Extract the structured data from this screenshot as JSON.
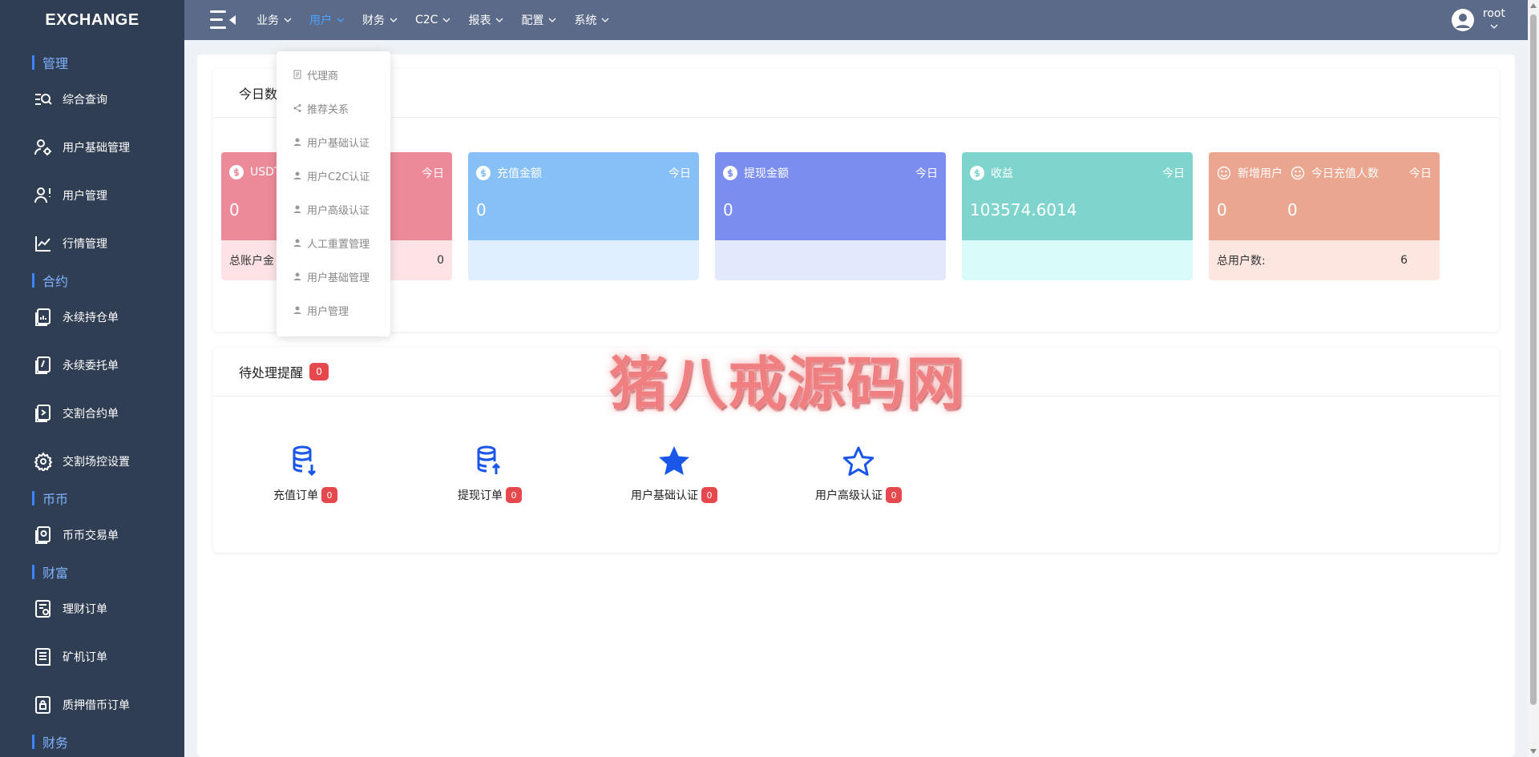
{
  "app": {
    "logo": "EXCHANGE"
  },
  "sidebar": {
    "sections": [
      {
        "title": "管理",
        "items": [
          {
            "label": "综合查询",
            "icon": "search-list-icon"
          },
          {
            "label": "用户基础管理",
            "icon": "user-settings-icon"
          },
          {
            "label": "用户管理",
            "icon": "user-alert-icon"
          },
          {
            "label": "行情管理",
            "icon": "line-chart-icon"
          }
        ]
      },
      {
        "title": "合约",
        "items": [
          {
            "label": "永续持仓单",
            "icon": "chart-doc-icon"
          },
          {
            "label": "永续委托单",
            "icon": "entrust-doc-icon"
          },
          {
            "label": "交割合约单",
            "icon": "contract-doc-icon"
          },
          {
            "label": "交割场控设置",
            "icon": "gear-icon"
          }
        ]
      },
      {
        "title": "币币",
        "items": [
          {
            "label": "币币交易单",
            "icon": "coin-doc-icon"
          }
        ]
      },
      {
        "title": "财富",
        "items": [
          {
            "label": "理财订单",
            "icon": "finance-doc-icon"
          },
          {
            "label": "矿机订单",
            "icon": "list-doc-icon"
          },
          {
            "label": "质押借币订单",
            "icon": "lock-doc-icon"
          }
        ]
      },
      {
        "title": "财务",
        "items": []
      }
    ]
  },
  "topnav": {
    "items": [
      "业务",
      "用户",
      "财务",
      "C2C",
      "报表",
      "配置",
      "系统"
    ],
    "active": "用户",
    "user": "root"
  },
  "dropdown": {
    "items": [
      {
        "label": "代理商",
        "icon": "doc-icon"
      },
      {
        "label": "推荐关系",
        "icon": "share-icon"
      },
      {
        "label": "用户基础认证",
        "icon": "person-icon"
      },
      {
        "label": "用户C2C认证",
        "icon": "person-icon"
      },
      {
        "label": "用户高级认证",
        "icon": "person-icon"
      },
      {
        "label": "人工重置管理",
        "icon": "person-icon"
      },
      {
        "label": "用户基础管理",
        "icon": "person-icon"
      },
      {
        "label": "用户管理",
        "icon": "person-icon"
      }
    ]
  },
  "today_panel": {
    "title": "今日数",
    "cards": [
      {
        "title": "USDT",
        "today": "今日",
        "value": "0",
        "footer_label": "总账户金",
        "footer_value": "0",
        "top_color": "#ec8a99",
        "bot_color": "#fde3e6"
      },
      {
        "title": "充值金额",
        "today": "今日",
        "value": "0",
        "footer_label": "",
        "footer_value": "",
        "top_color": "#86c0f7",
        "bot_color": "#e0efff"
      },
      {
        "title": "提现金额",
        "today": "今日",
        "value": "0",
        "footer_label": "",
        "footer_value": "",
        "top_color": "#7b8ef0",
        "bot_color": "#e4e8fd"
      },
      {
        "title": "收益",
        "today": "今日",
        "value": "103574.6014",
        "footer_label": "",
        "footer_value": "",
        "top_color": "#7fd5cd",
        "bot_color": "#dafcf8"
      },
      {
        "title": "新增用户",
        "title2": "今日充值人数",
        "today": "今日",
        "value": "0",
        "value2": "0",
        "footer_label": "总用户数:",
        "footer_value": "6",
        "top_color": "#eba68f",
        "bot_color": "#fde6e0"
      }
    ]
  },
  "todo_panel": {
    "title": "待处理提醒",
    "badge": "0",
    "items": [
      {
        "label": "充值订单",
        "count": "0",
        "icon": "database-download-icon"
      },
      {
        "label": "提现订单",
        "count": "0",
        "icon": "database-upload-icon"
      },
      {
        "label": "用户基础认证",
        "count": "0",
        "icon": "star-filled-icon"
      },
      {
        "label": "用户高级认证",
        "count": "0",
        "icon": "star-outline-icon"
      }
    ]
  },
  "watermark": "猪八戒源码网"
}
